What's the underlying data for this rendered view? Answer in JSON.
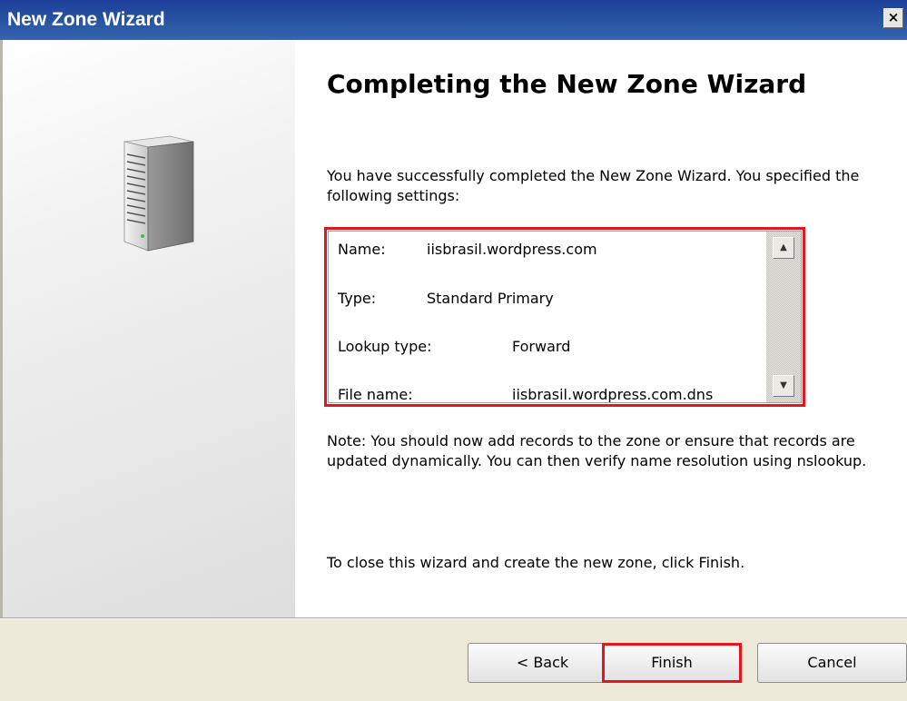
{
  "window": {
    "title": "New Zone Wizard",
    "close_symbol": "×"
  },
  "heading": "Completing the New Zone Wizard",
  "intro_text": "You have successfully completed the New Zone Wizard. You specified the following settings:",
  "settings": [
    {
      "label": "Name:",
      "value": "iisbrasil.wordpress.com"
    },
    {
      "label": "Type:",
      "value": "Standard Primary"
    },
    {
      "label": "Lookup type:",
      "value": "Forward"
    },
    {
      "label": "File name:",
      "value": "iisbrasil.wordpress.com.dns"
    }
  ],
  "scroll": {
    "up_symbol": "▲",
    "down_symbol": "▼"
  },
  "note_text": "Note: You should now add records to the zone or ensure that records are updated dynamically. You can then verify name resolution using nslookup.",
  "closing_text": "To close this wizard and create the new zone, click Finish.",
  "buttons": {
    "back": "< Back",
    "finish": "Finish",
    "cancel": "Cancel"
  },
  "colors": {
    "titlebar": "#27519f",
    "highlight": "#e5151d",
    "panel": "#ece9d8"
  },
  "icons": {
    "wizard_image": "server-tower-icon",
    "close": "close-icon"
  }
}
